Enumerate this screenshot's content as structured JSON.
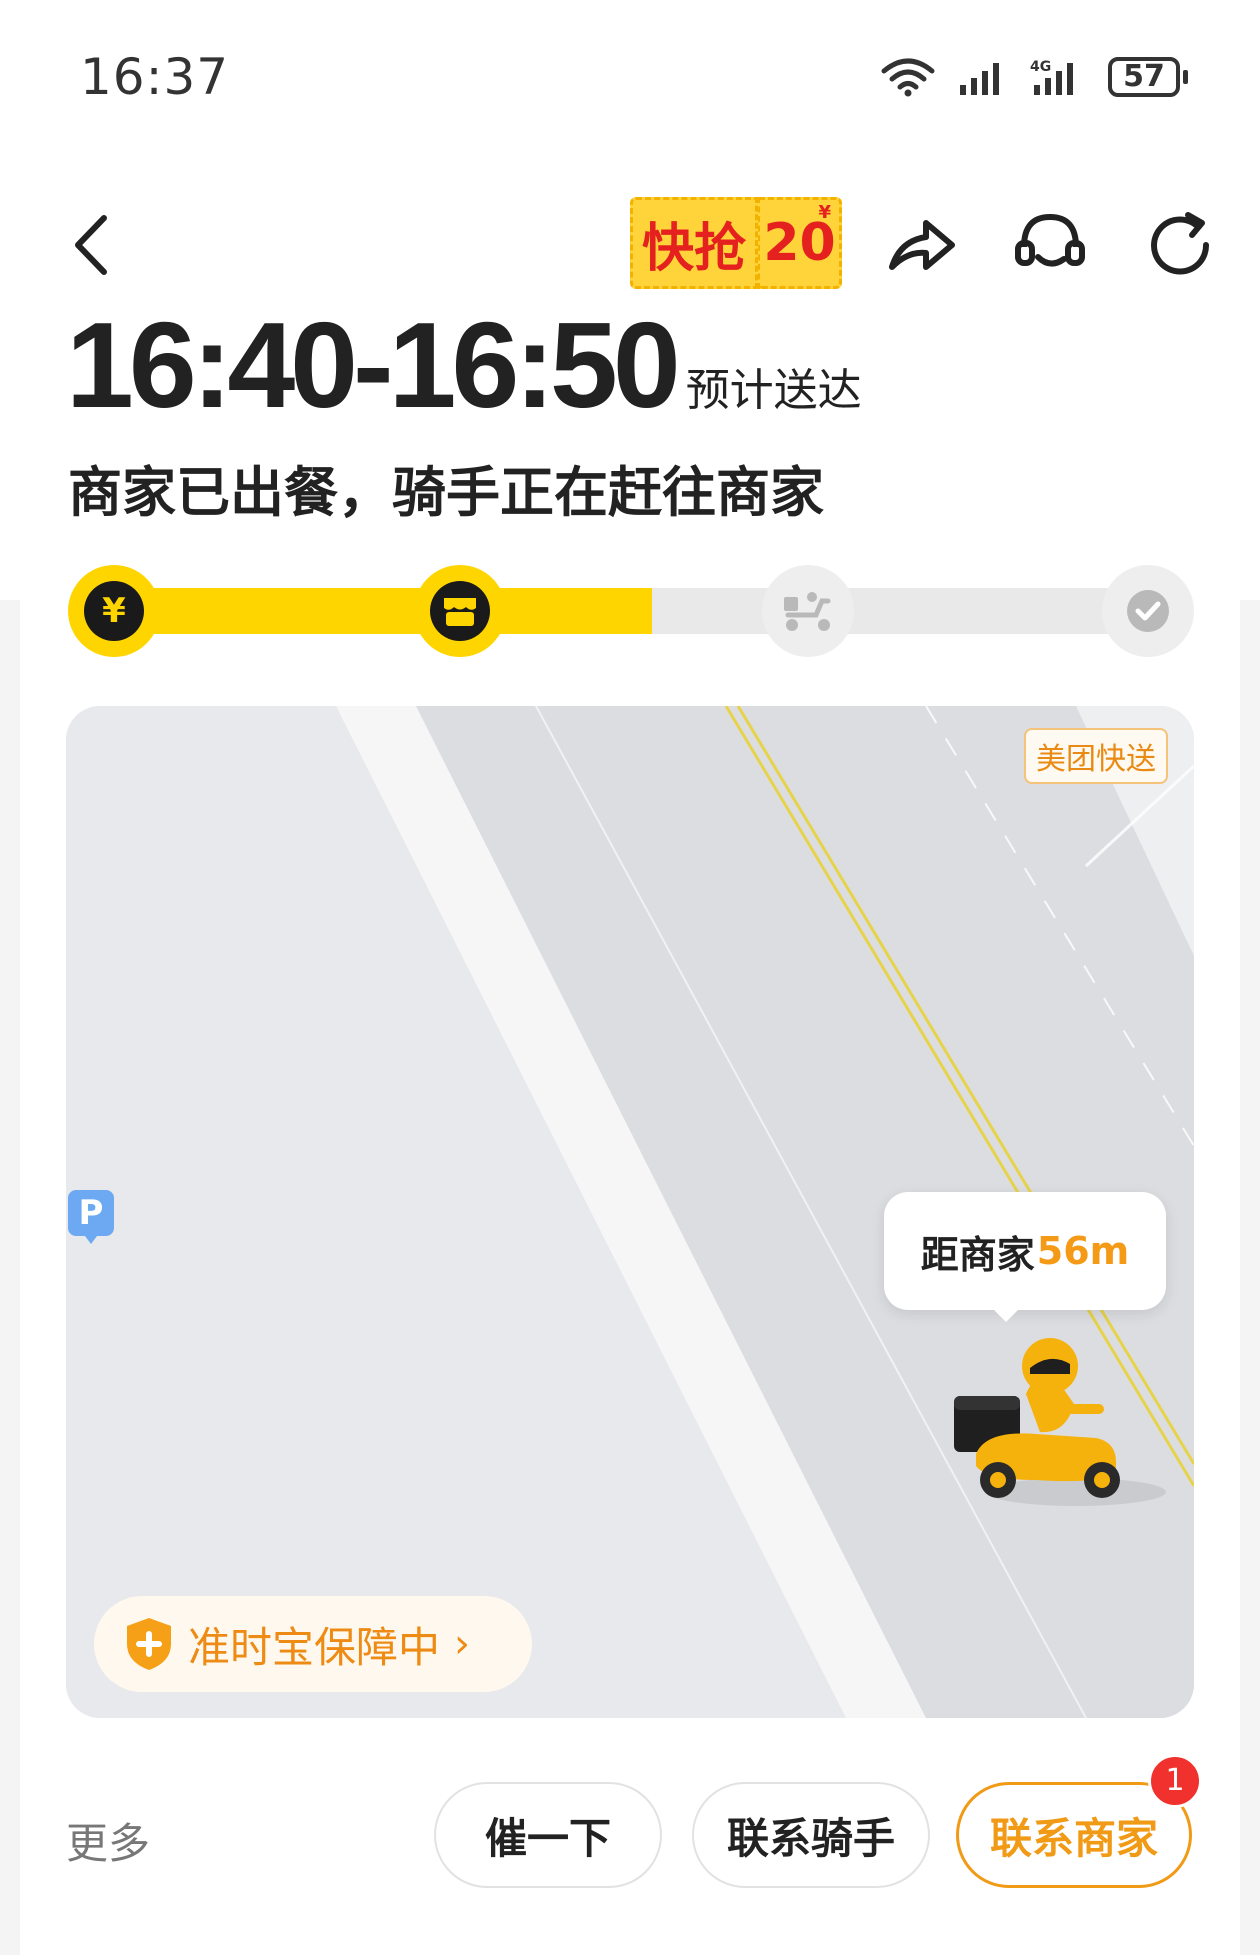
{
  "status_bar": {
    "time": "16:37",
    "battery": "57"
  },
  "header": {
    "promo_left": "快抢",
    "promo_right": "20",
    "promo_currency": "¥"
  },
  "eta": {
    "time_range": "16:40-16:50",
    "label": "预计送达"
  },
  "order_status": "商家已出餐，骑手正在赶往商家",
  "progress": {
    "completed_steps": 2,
    "total_steps": 4,
    "step_1_symbol": "¥",
    "fill_fraction": 0.52
  },
  "map": {
    "brand_tag": "美团快送",
    "parking_label": "P",
    "distance_prefix": "距商家",
    "distance_value": "56m",
    "insurance_label": "准时宝保障中",
    "insurance_chevron": "›"
  },
  "actions": {
    "more_label": "更多",
    "urge_label": "催一下",
    "contact_rider_label": "联系骑手",
    "contact_merchant_label": "联系商家",
    "merchant_badge_count": "1"
  },
  "colors": {
    "accent_yellow": "#ffd500",
    "accent_orange": "#f09a16",
    "badge_red": "#f0312d"
  }
}
